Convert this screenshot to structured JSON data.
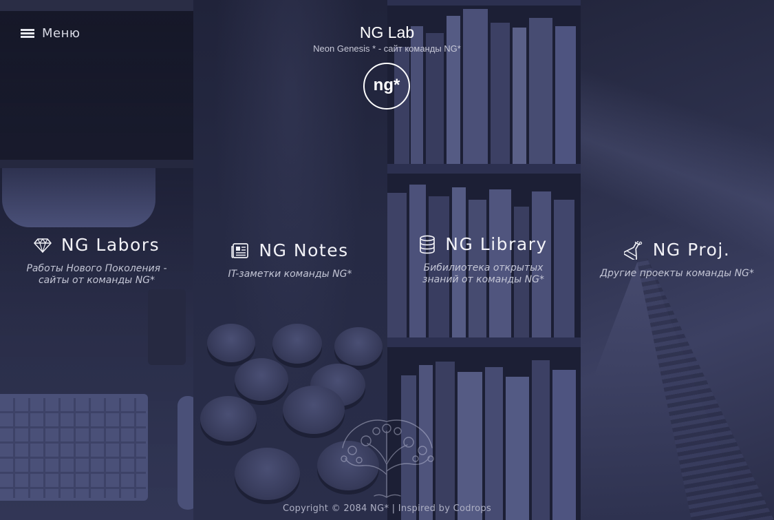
{
  "header": {
    "menu_label": "Меню",
    "site_title": "NG Lab",
    "site_subtitle": "Neon Genesis * - сайт команды NG*",
    "logo_text": "ng*"
  },
  "sections": [
    {
      "icon": "diamond-icon",
      "title": "NG Labors",
      "description_lines": [
        "Работы Нового Поколения -",
        "сайты от команды NG*"
      ]
    },
    {
      "icon": "newspaper-icon",
      "title": "NG Notes",
      "description_lines": [
        "IT-заметки команды NG*"
      ]
    },
    {
      "icon": "database-icon",
      "title": "NG Library",
      "description_lines": [
        "Бибилиотека открытых",
        "знаний от команды NG*"
      ]
    },
    {
      "icon": "flask-icon",
      "title": "NG Proj.",
      "description_lines": [
        "Другие проекты команды NG*"
      ]
    }
  ],
  "footer": {
    "copyright": "Copyright © 2084 NG* | Inspired by Codrops",
    "tree_icon": "tree-icon"
  }
}
